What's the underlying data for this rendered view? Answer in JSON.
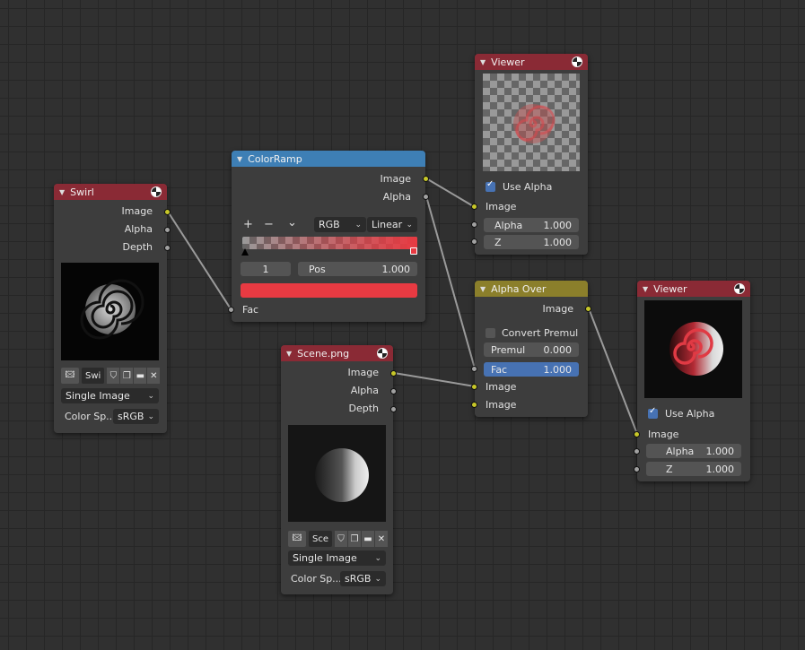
{
  "nodes": {
    "swirl": {
      "title": "Swirl",
      "outputs": [
        "Image",
        "Alpha",
        "Depth"
      ],
      "image_name": "Swi",
      "source": "Single Image",
      "colorspace_label": "Color Sp...",
      "colorspace_value": "sRGB"
    },
    "colorramp": {
      "title": "ColorRamp",
      "outputs": [
        "Image",
        "Alpha"
      ],
      "tools": [
        "+",
        "−",
        "⌄"
      ],
      "color_mode": "RGB",
      "interpolation": "Linear",
      "stop_index": "1",
      "pos_label": "Pos",
      "pos_value": "1.000",
      "swatch_color": "#e83a42",
      "input": "Fac"
    },
    "scene": {
      "title": "Scene.png",
      "outputs": [
        "Image",
        "Alpha",
        "Depth"
      ],
      "image_name": "Sce",
      "source": "Single Image",
      "colorspace_label": "Color Sp...",
      "colorspace_value": "sRGB"
    },
    "viewer1": {
      "title": "Viewer",
      "use_alpha": "Use Alpha",
      "input_image": "Image",
      "alpha_label": "Alpha",
      "alpha_value": "1.000",
      "z_label": "Z",
      "z_value": "1.000"
    },
    "alphaover": {
      "title": "Alpha Over",
      "output": "Image",
      "convert_premul": "Convert Premul",
      "premul_label": "Premul",
      "premul_value": "0.000",
      "fac_label": "Fac",
      "fac_value": "1.000",
      "input_image1": "Image",
      "input_image2": "Image"
    },
    "viewer2": {
      "title": "Viewer",
      "output": "Image",
      "use_alpha": "Use Alpha",
      "input_image": "Image",
      "alpha_label": "Alpha",
      "alpha_value": "1.000",
      "z_label": "Z",
      "z_value": "1.000"
    }
  },
  "colors": {
    "header_red": "#8a2a35",
    "header_blue": "#3e7fb5",
    "header_olive": "#8b7f2b",
    "socket_image": "#c7c729",
    "socket_value": "#a1a1a1",
    "accent": "#4772b3"
  },
  "icons": [
    "collapse-triangle-icon",
    "node-preview-icon",
    "image-browse-icon",
    "fake-user-shield-icon",
    "duplicate-icon",
    "folder-icon",
    "close-icon",
    "chevron-down-icon"
  ]
}
